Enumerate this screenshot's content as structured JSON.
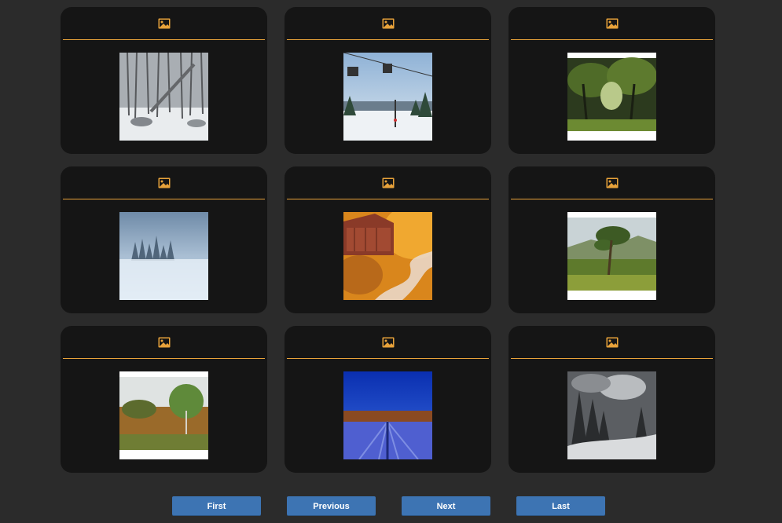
{
  "theme": {
    "accent": "#e8a23a",
    "card_bg": "#151515",
    "page_bg": "#2b2b2b",
    "button_bg": "#3d74b3"
  },
  "gallery": {
    "items": [
      {
        "header_icon": "image-icon",
        "thumbnail": "snowy-forest"
      },
      {
        "header_icon": "image-icon",
        "thumbnail": "ski-chairlift"
      },
      {
        "header_icon": "image-icon",
        "thumbnail": "green-woodland"
      },
      {
        "header_icon": "image-icon",
        "thumbnail": "misty-winter-forest"
      },
      {
        "header_icon": "image-icon",
        "thumbnail": "autumn-covered-bridge"
      },
      {
        "header_icon": "image-icon",
        "thumbnail": "scots-pine-highlands"
      },
      {
        "header_icon": "image-icon",
        "thumbnail": "autumn-bracken-birch"
      },
      {
        "header_icon": "image-icon",
        "thumbnail": "blue-sky-snow-field"
      },
      {
        "header_icon": "image-icon",
        "thumbnail": "dark-snowy-pines"
      }
    ]
  },
  "pagination": {
    "first": "First",
    "previous": "Previous",
    "next": "Next",
    "last": "Last"
  }
}
